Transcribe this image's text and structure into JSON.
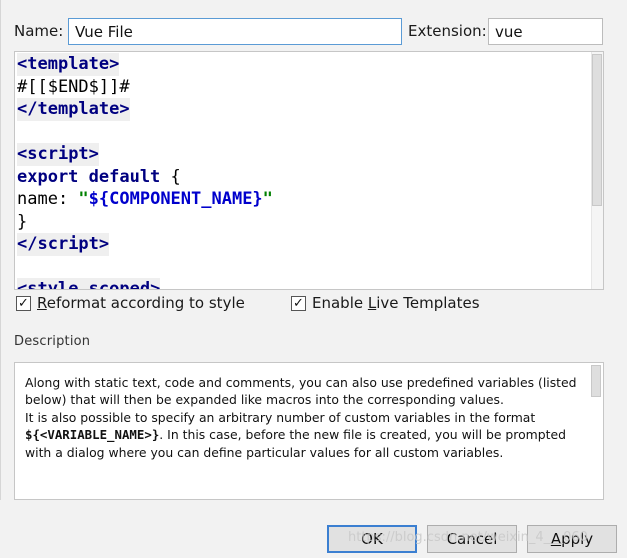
{
  "form": {
    "name_label": "Name:",
    "name_value": "Vue File",
    "extension_label": "Extension:",
    "extension_value": "vue"
  },
  "editor": {
    "lines": [
      {
        "parts": [
          {
            "t": "<",
            "c": "tag"
          },
          {
            "t": "template",
            "c": "tag"
          },
          {
            "t": ">",
            "c": "tag"
          }
        ],
        "bg": true
      },
      {
        "parts": [
          {
            "t": "#[[$END$]]#",
            "c": "plain"
          }
        ],
        "bg": false
      },
      {
        "parts": [
          {
            "t": "</",
            "c": "tag"
          },
          {
            "t": "template",
            "c": "tag"
          },
          {
            "t": ">",
            "c": "tag"
          }
        ],
        "bg": true
      },
      {
        "parts": [],
        "bg": false
      },
      {
        "parts": [
          {
            "t": "<",
            "c": "tag"
          },
          {
            "t": "script",
            "c": "tag"
          },
          {
            "t": ">",
            "c": "tag"
          }
        ],
        "bg": true
      },
      {
        "parts": [
          {
            "t": "export default",
            "c": "kw"
          },
          {
            "t": " {",
            "c": "plain"
          }
        ],
        "bg": false
      },
      {
        "parts": [
          {
            "t": "name: ",
            "c": "plain"
          },
          {
            "t": "\"",
            "c": "str"
          },
          {
            "t": "${COMPONENT_NAME}",
            "c": "var"
          },
          {
            "t": "\"",
            "c": "str"
          }
        ],
        "bg": false
      },
      {
        "parts": [
          {
            "t": "}",
            "c": "plain"
          }
        ],
        "bg": false
      },
      {
        "parts": [
          {
            "t": "</",
            "c": "tag"
          },
          {
            "t": "script",
            "c": "tag"
          },
          {
            "t": ">",
            "c": "tag"
          }
        ],
        "bg": true
      },
      {
        "parts": [],
        "bg": false
      },
      {
        "parts": [
          {
            "t": "<",
            "c": "tag"
          },
          {
            "t": "style scoped",
            "c": "tag"
          },
          {
            "t": ">",
            "c": "tag"
          }
        ],
        "bg": true
      }
    ]
  },
  "options": {
    "reformat": {
      "before": "",
      "mnemonic": "R",
      "after": "eformat according to style",
      "checked": true
    },
    "live_templates": {
      "before": "Enable ",
      "mnemonic": "L",
      "after": "ive Templates",
      "checked": true
    }
  },
  "description": {
    "title": "Description",
    "p1": "Along with static text, code and comments, you can also use predefined variables (listed below) that will then be expanded like macros into the corresponding values.",
    "p2_a": "It is also possible to specify an arbitrary number of custom variables in the format ",
    "p2_var": "${<VARIABLE_NAME>}",
    "p2_b": ". In this case, before the new file is created, you will be prompted with a dialog where you can define particular values for all custom variables."
  },
  "buttons": {
    "ok": "OK",
    "cancel": "Cancel",
    "apply_before": "",
    "apply_mnemonic": "A",
    "apply_after": "pply"
  },
  "watermark": "https://blog.csdn.net/weixin_4___060"
}
